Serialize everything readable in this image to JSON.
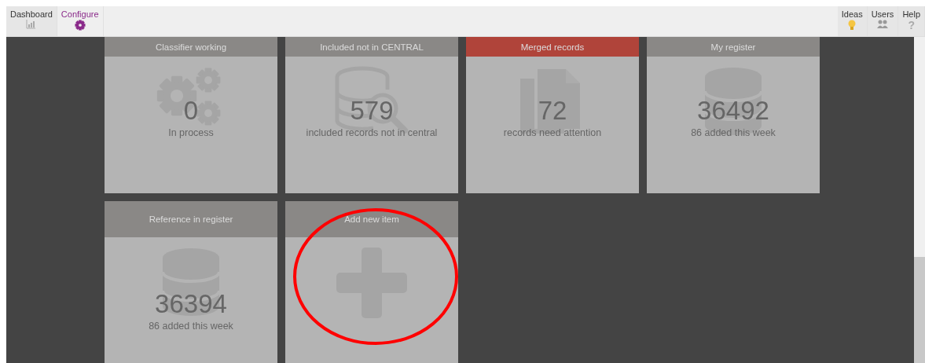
{
  "nav_left": [
    {
      "label": "Dashboard",
      "kind": "chart",
      "selected": false
    },
    {
      "label": "Configure",
      "kind": "gear",
      "selected": true
    }
  ],
  "nav_right": [
    {
      "label": "Ideas",
      "kind": "bulb"
    },
    {
      "label": "Users",
      "kind": "users"
    },
    {
      "label": "Help",
      "kind": "glyph",
      "glyph": "?"
    }
  ],
  "tiles": [
    {
      "kind": "gears",
      "title": "Classifier working",
      "alert": false,
      "value": "0",
      "caption": "In process"
    },
    {
      "kind": "db-search",
      "title": "Included not in CENTRAL",
      "alert": false,
      "value": "579",
      "caption": "included records not in central"
    },
    {
      "kind": "documents",
      "title": "Merged records",
      "alert": true,
      "value": "72",
      "caption": "records need attention"
    },
    {
      "kind": "database",
      "title": "My register",
      "alert": false,
      "value": "36492",
      "caption": "86 added this week"
    },
    {
      "kind": "database",
      "title": "Reference in register",
      "alert": false,
      "value": "36394",
      "caption": "86 added this week"
    },
    {
      "kind": "add",
      "title": "Add new item",
      "alert": false
    }
  ]
}
